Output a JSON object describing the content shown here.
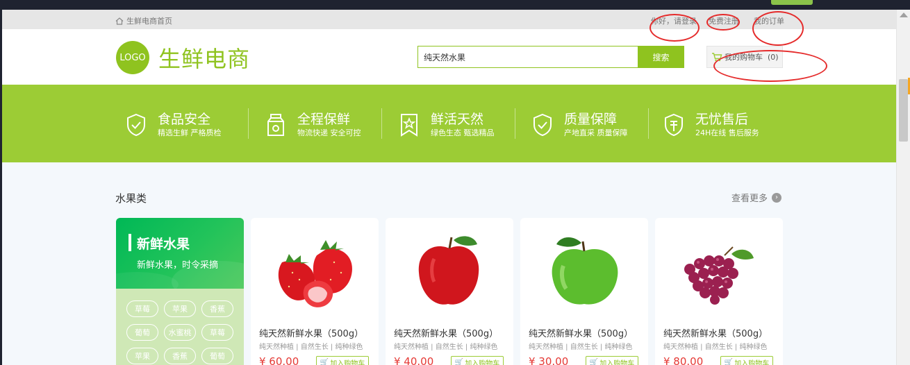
{
  "topbar": {
    "home_label": "生鲜电商首页",
    "greeting": "你好，请登录",
    "register": "免费注册",
    "orders": "我的订单"
  },
  "header": {
    "logo_text": "LOGO",
    "site_name": "生鲜电商",
    "search_value": "纯天然水果",
    "search_button": "搜索",
    "cart_label": "我的购物车",
    "cart_count": "(0)"
  },
  "banner": {
    "features": [
      {
        "title": "食品安全",
        "sub": "精选生鲜 严格质检",
        "icon": "shield-check-icon"
      },
      {
        "title": "全程保鲜",
        "sub": "物流快递 安全可控",
        "icon": "milk-box-icon"
      },
      {
        "title": "鲜活天然",
        "sub": "绿色生态 甄选精品",
        "icon": "bookmark-star-icon"
      },
      {
        "title": "质量保障",
        "sub": "产地直采 质量保障",
        "icon": "shield-check-icon"
      },
      {
        "title": "无忧售后",
        "sub": "24H在线 售后服务",
        "icon": "service-shield-icon"
      }
    ]
  },
  "section": {
    "title": "水果类",
    "more": "查看更多"
  },
  "category": {
    "title": "新鲜水果",
    "subtitle": "新鲜水果，时令采摘",
    "tags": [
      "草莓",
      "苹果",
      "香蕉",
      "葡萄",
      "水蜜桃",
      "草莓",
      "苹果",
      "香蕉",
      "葡萄"
    ]
  },
  "products": [
    {
      "name": "纯天然新鲜水果（500g）",
      "tags": "纯天然种植 | 自然生长 | 纯种绿色",
      "price": "¥ 60.00",
      "add": "加入购物车",
      "image": "strawberry"
    },
    {
      "name": "纯天然新鲜水果（500g）",
      "tags": "纯天然种植 | 自然生长 | 纯种绿色",
      "price": "¥ 40.00",
      "add": "加入购物车",
      "image": "red-apple"
    },
    {
      "name": "纯天然新鲜水果（500g）",
      "tags": "纯天然种植 | 自然生长 | 纯种绿色",
      "price": "¥ 30.00",
      "add": "加入购物车",
      "image": "green-apple"
    },
    {
      "name": "纯天然新鲜水果（500g）",
      "tags": "纯天然种植 | 自然生长 | 纯种绿色",
      "price": "¥ 80.00",
      "add": "加入购物车",
      "image": "grapes"
    }
  ],
  "colors": {
    "brand_green": "#8fc31f",
    "banner_green": "#9ccc35",
    "price_red": "#e53935",
    "annotation_red": "#e52b2b"
  }
}
